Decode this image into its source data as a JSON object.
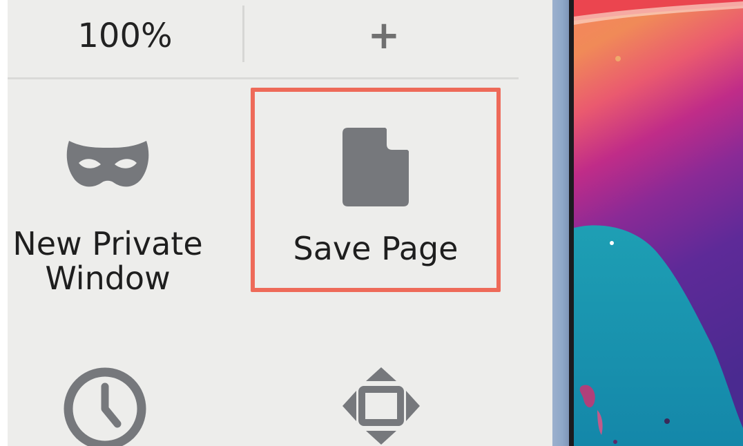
{
  "zoom": {
    "value": "100%",
    "zoom_in_symbol": "+"
  },
  "menu_items": {
    "new_private_window": {
      "label_line1": "New Private",
      "label_line2": "Window",
      "icon": "mask-icon"
    },
    "save_page": {
      "label": "Save Page",
      "icon": "document-icon"
    },
    "history": {
      "icon": "clock-icon"
    },
    "full_screen": {
      "icon": "fullscreen-arrows-icon"
    }
  },
  "colors": {
    "panel_bg": "#ededeb",
    "icon_gray": "#76787c",
    "highlight": "#ee6a59",
    "text": "#1e1e1e"
  }
}
